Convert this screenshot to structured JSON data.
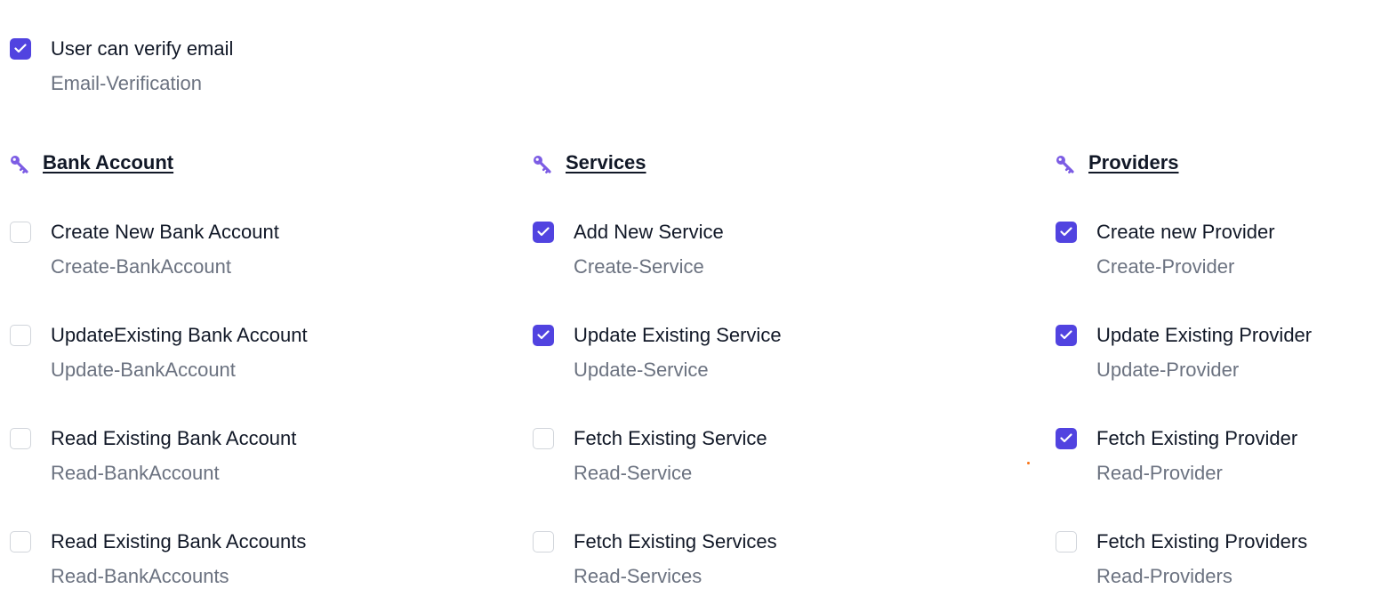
{
  "colors": {
    "accent": "#5143e0",
    "key_icon": "#7c5ce4",
    "label": "#111827",
    "code": "#6b7280",
    "checkbox_border": "#d1d5db"
  },
  "standalone": {
    "label": "User can verify email",
    "code": "Email-Verification",
    "checked": true
  },
  "groups": [
    {
      "title": "Bank Account",
      "icon": "key-icon",
      "items": [
        {
          "label": "Create New Bank Account",
          "code": "Create-BankAccount",
          "checked": false
        },
        {
          "label": "UpdateExisting Bank Account",
          "code": "Update-BankAccount",
          "checked": false
        },
        {
          "label": "Read Existing Bank Account",
          "code": "Read-BankAccount",
          "checked": false
        },
        {
          "label": "Read Existing Bank Accounts",
          "code": "Read-BankAccounts",
          "checked": false
        }
      ]
    },
    {
      "title": "Services",
      "icon": "key-icon",
      "items": [
        {
          "label": "Add New Service",
          "code": "Create-Service",
          "checked": true
        },
        {
          "label": "Update Existing Service",
          "code": "Update-Service",
          "checked": true
        },
        {
          "label": "Fetch Existing Service",
          "code": "Read-Service",
          "checked": false
        },
        {
          "label": "Fetch Existing Services",
          "code": "Read-Services",
          "checked": false
        }
      ]
    },
    {
      "title": "Providers",
      "icon": "key-icon",
      "items": [
        {
          "label": "Create new Provider",
          "code": "Create-Provider",
          "checked": true
        },
        {
          "label": "Update Existing Provider",
          "code": "Update-Provider",
          "checked": true
        },
        {
          "label": "Fetch Existing Provider",
          "code": "Read-Provider",
          "checked": true
        },
        {
          "label": "Fetch Existing Providers",
          "code": "Read-Providers",
          "checked": false
        }
      ]
    }
  ]
}
